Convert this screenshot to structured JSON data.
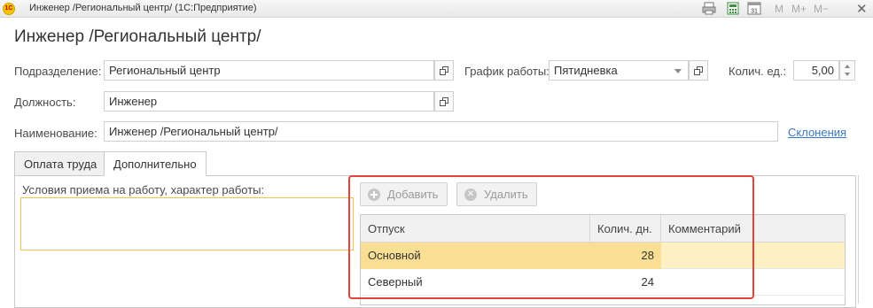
{
  "window": {
    "logo_text": "1С",
    "title": "Инженер /Региональный центр/  (1С:Предприятие)",
    "m_buttons": [
      "M",
      "M+",
      "M−"
    ],
    "close_glyph": "✕",
    "calendar_day": "31"
  },
  "page_title": "Инженер /Региональный центр/",
  "form": {
    "subdivision_label": "Подразделение:",
    "subdivision_value": "Региональный центр",
    "schedule_label": "График работы:",
    "schedule_value": "Пятидневка",
    "qty_label": "Колич. ед.:",
    "qty_value": "5,00",
    "position_label": "Должность:",
    "position_value": "Инженер",
    "name_label": "Наименование:",
    "name_value": "Инженер /Региональный центр/",
    "declension_link": "Склонения"
  },
  "tabs": [
    {
      "label": "Оплата труда",
      "active": false
    },
    {
      "label": "Дополнительно",
      "active": true
    }
  ],
  "additional": {
    "conditions_label": "Условия приема на работу, характер работы:",
    "conditions_value": ""
  },
  "toolbar": {
    "add_label": "Добавить",
    "delete_label": "Удалить",
    "delete_glyph": "✕"
  },
  "vacation_table": {
    "columns": [
      "Отпуск",
      "Колич. дн.",
      "Комментарий"
    ],
    "rows": [
      {
        "vacation": "Основной",
        "days": "28",
        "comment": "",
        "selected": true
      },
      {
        "vacation": "Северный",
        "days": "24",
        "comment": "",
        "selected": false
      }
    ]
  },
  "colors": {
    "highlight_frame": "#e0443a",
    "selected_row": "#fdf1c3",
    "link": "#3b78c2"
  }
}
